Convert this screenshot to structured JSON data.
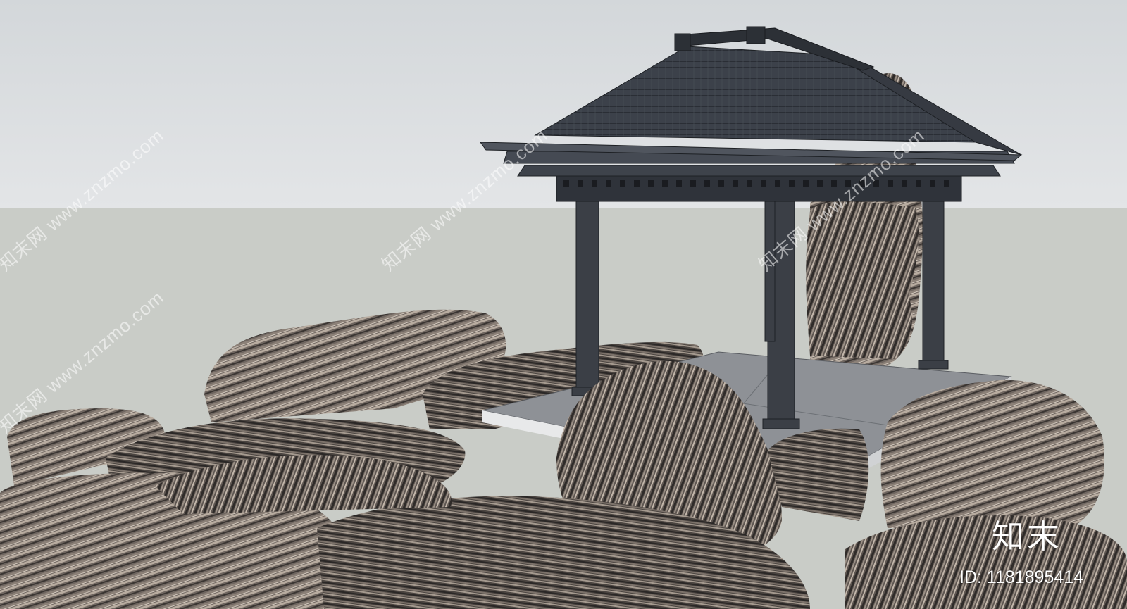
{
  "scene": {
    "sky_color": "#d6dadd",
    "ground_color": "#c8cbc6",
    "roof_color": "#3a3f47",
    "rock_light": "#9a8e84",
    "rock_dark": "#2e2b2a"
  },
  "watermark": {
    "repeated_text": "知末网 www.znzmo.com",
    "logo_text": "知末",
    "id_text": "ID: 1181895414"
  }
}
